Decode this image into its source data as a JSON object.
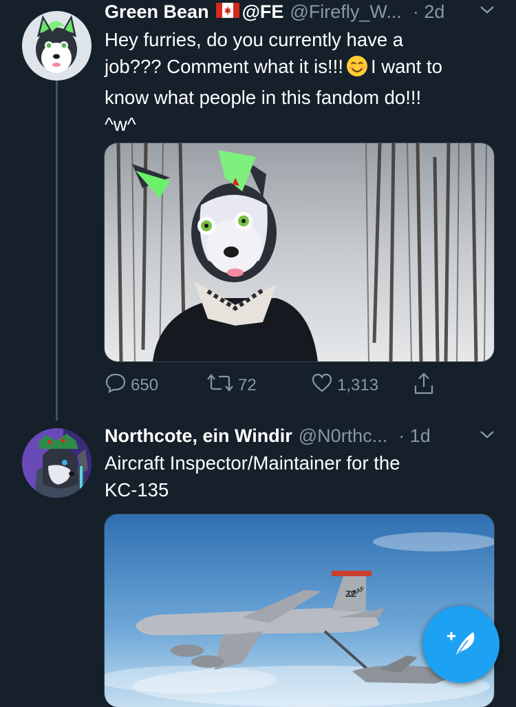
{
  "tweets": [
    {
      "name": "Green Bean",
      "badge": "@FE",
      "handle": "@Firefly_W...",
      "time": "· 2d",
      "text_lines": [
        "Hey furries, do you currently have a",
        "job??? Comment what it is!!!",
        "I want to",
        "know what people in this fandom do!!!",
        "^w^"
      ],
      "replies": "650",
      "retweets": "72",
      "likes": "1,313",
      "flag": "canada-flag-icon",
      "emoji": "smiling-face-icon"
    },
    {
      "name": "Northcote, ein Windir",
      "handle": "@N0rthc...",
      "time": "· 1d",
      "text_lines": [
        "Aircraft Inspector/Maintainer for the",
        "KC-135"
      ],
      "aircraft_markings": {
        "tail_code": "ZZ",
        "fuselage": "USAF"
      }
    }
  ],
  "colors": {
    "background": "#15202b",
    "secondary_text": "#8899a6",
    "accent": "#1da1f2"
  },
  "icons": [
    "reply-icon",
    "retweet-icon",
    "like-icon",
    "share-icon",
    "chevron-down-icon",
    "compose-tweet-icon"
  ]
}
